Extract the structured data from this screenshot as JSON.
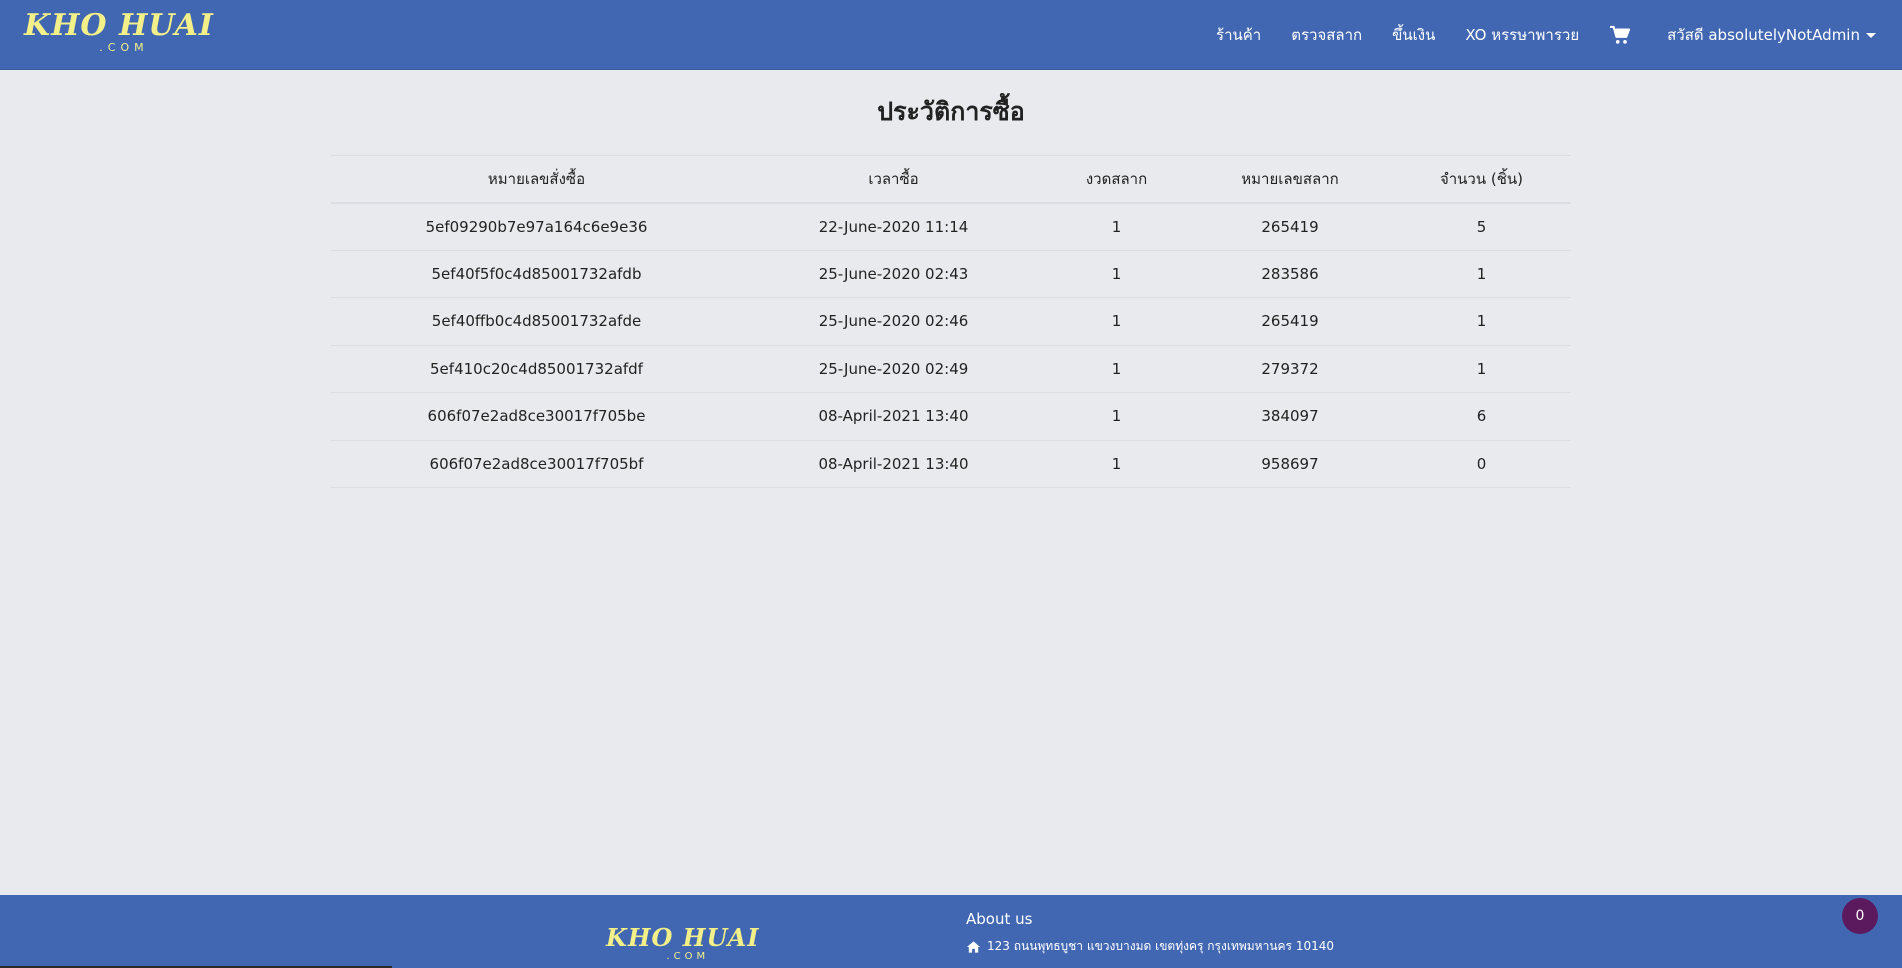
{
  "navbar": {
    "brand_main": "KHO HUAI",
    "brand_sub": ".COM",
    "links": [
      "ร้านค้า",
      "ตรวจสลาก",
      "ขึ้นเงิน",
      "XO หรรษาพารวย"
    ],
    "cart_icon": "cart-icon",
    "user_greeting": "สวัสดี absolutelyNotAdmin"
  },
  "main": {
    "title": "ประวัติการซื้อ",
    "table": {
      "headers": [
        "หมายเลขสั่งซื้อ",
        "เวลาซื้อ",
        "งวดสลาก",
        "หมายเลขสลาก",
        "จำนวน (ชิ้น)"
      ],
      "rows": [
        [
          "5ef09290b7e97a164c6e9e36",
          "22-June-2020 11:14",
          "1",
          "265419",
          "5"
        ],
        [
          "5ef40f5f0c4d85001732afdb",
          "25-June-2020 02:43",
          "1",
          "283586",
          "1"
        ],
        [
          "5ef40ffb0c4d85001732afde",
          "25-June-2020 02:46",
          "1",
          "265419",
          "1"
        ],
        [
          "5ef410c20c4d85001732afdf",
          "25-June-2020 02:49",
          "1",
          "279372",
          "1"
        ],
        [
          "606f07e2ad8ce30017f705be",
          "08-April-2021 13:40",
          "1",
          "384097",
          "6"
        ],
        [
          "606f07e2ad8ce30017f705bf",
          "08-April-2021 13:40",
          "1",
          "958697",
          "0"
        ]
      ]
    }
  },
  "footer": {
    "brand_main": "KHO HUAI",
    "brand_sub": ".COM",
    "about_title": "About us",
    "address": "123 ถนนพุทธบูชา แขวงบางมด เขตทุ่งครุ กรุงเทพมหานคร 10140",
    "address_icon": "home-icon"
  },
  "chat_badge": "0",
  "colors": {
    "navbar": "#4267b2",
    "brand": "#f3f089",
    "background": "#e9eaee",
    "chat_badge": "#5b1a5e"
  }
}
